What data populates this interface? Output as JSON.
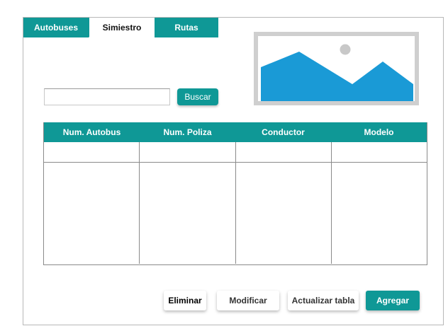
{
  "tabs": [
    {
      "label": "Autobuses"
    },
    {
      "label": "Simiestro"
    },
    {
      "label": "Rutas"
    }
  ],
  "search": {
    "placeholder": "",
    "value": "",
    "button_label": "Buscar"
  },
  "table": {
    "headers": [
      "Num. Autobus",
      "Num. Poliza",
      "Conductor",
      "Modelo"
    ],
    "rows": []
  },
  "actions": {
    "eliminar": "Eliminar",
    "modificar": "Modificar",
    "actualizar": "Actualizar tabla",
    "agregar": "Agregar"
  },
  "colors": {
    "accent": "#0f9896",
    "image_fill": "#1a9ad6",
    "image_border": "#cfcfcf"
  },
  "icons": {
    "image_placeholder": "image-placeholder-icon"
  }
}
